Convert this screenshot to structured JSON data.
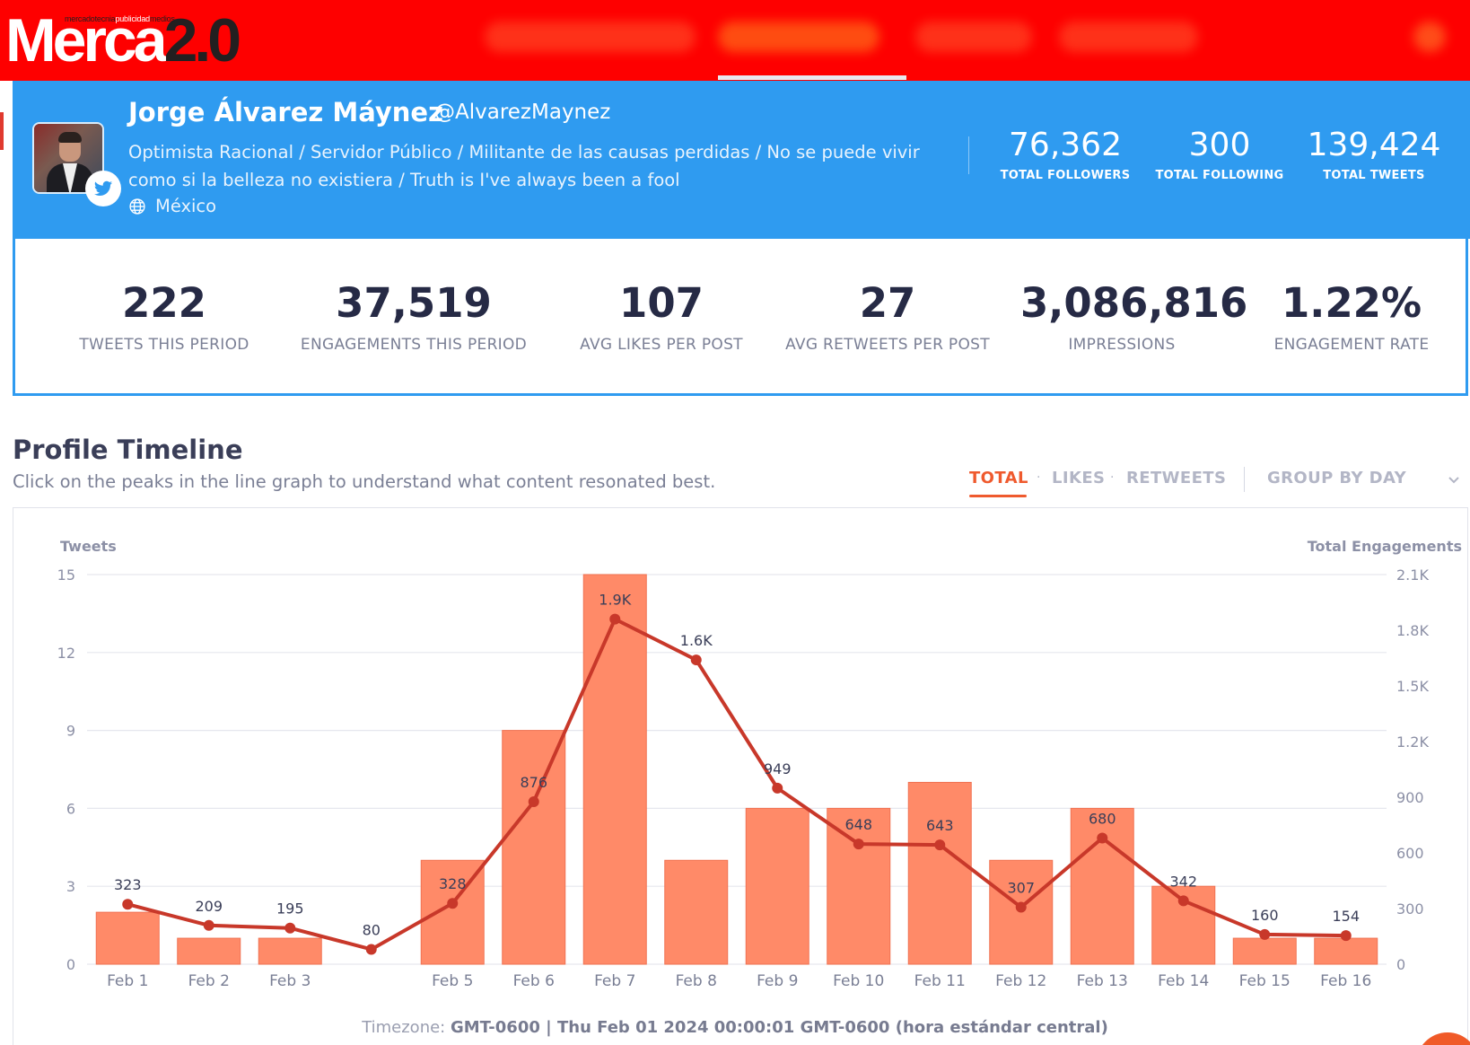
{
  "brand": {
    "logo_main": "Merca",
    "logo_num": "2.0",
    "logo_tag_a": "mercadotecnia",
    "logo_tag_b": "publicidad",
    "logo_tag_c": "medios",
    "color_red": "#fe0000",
    "color_blue": "#2f9bf0",
    "color_accent": "#ef5a2e"
  },
  "profile": {
    "name": "Jorge Álvarez Máynez",
    "handle": "@AlvarezMaynez",
    "bio": "Optimista Racional / Servidor Público / Militante de las causas perdidas / No se puede vivir como si la belleza no existiera / Truth is I've always been a fool",
    "location": "México",
    "stats": [
      {
        "value": "76,362",
        "label": "TOTAL FOLLOWERS"
      },
      {
        "value": "300",
        "label": "TOTAL FOLLOWING"
      },
      {
        "value": "139,424",
        "label": "TOTAL TWEETS"
      }
    ]
  },
  "metrics": [
    {
      "value": "222",
      "label": "TWEETS THIS PERIOD"
    },
    {
      "value": "37,519",
      "label": "ENGAGEMENTS THIS PERIOD"
    },
    {
      "value": "107",
      "label": "AVG LIKES PER POST"
    },
    {
      "value": "27",
      "label": "AVG RETWEETS PER POST"
    },
    {
      "value": "3,086,816",
      "label": "IMPRESSIONS"
    },
    {
      "value": "1.22%",
      "label": "ENGAGEMENT RATE"
    }
  ],
  "timeline": {
    "title": "Profile Timeline",
    "subtitle": "Click on the peaks in the line graph to understand what content resonated best.",
    "tabs": [
      "TOTAL",
      "LIKES",
      "RETWEETS"
    ],
    "active_tab": "TOTAL",
    "group_by": "GROUP BY DAY",
    "timezone_label": "Timezone:",
    "timezone_value": "GMT-0600 | Thu Feb 01 2024 00:00:01 GMT-0600 (hora estándar central)"
  },
  "chart_data": {
    "type": "bar",
    "categories": [
      "Feb 1",
      "Feb 2",
      "Feb 3",
      "",
      "Feb 5",
      "Feb 6",
      "Feb 7",
      "Feb 8",
      "Feb 9",
      "Feb 10",
      "Feb 11",
      "Feb 12",
      "Feb 13",
      "Feb 14",
      "Feb 15",
      "Feb 16"
    ],
    "ylabel": "Tweets",
    "y2label": "Total Engagements",
    "ylim": [
      0,
      15
    ],
    "y2lim": [
      0,
      2100
    ],
    "yticks": [
      "0",
      "3",
      "6",
      "9",
      "12",
      "15"
    ],
    "y2ticks": [
      "0",
      "300",
      "600",
      "900",
      "1.2K",
      "1.5K",
      "1.8K",
      "2.1K"
    ],
    "grid": true,
    "series": [
      {
        "type": "bar",
        "axis": "left",
        "color": "#ff8a68",
        "values": [
          2,
          1,
          1,
          0,
          4,
          9,
          15,
          4,
          6,
          6,
          7,
          4,
          6,
          3,
          1,
          1
        ]
      },
      {
        "type": "line",
        "axis": "right",
        "color": "#c8382a",
        "values": [
          323,
          209,
          195,
          80,
          328,
          876,
          1860,
          1640,
          949,
          648,
          643,
          307,
          680,
          342,
          160,
          154
        ],
        "labels": [
          "323",
          "209",
          "195",
          "80",
          "328",
          "876",
          "1.9K",
          "1.6K",
          "949",
          "648",
          "643",
          "307",
          "680",
          "342",
          "160",
          "154"
        ]
      }
    ]
  }
}
